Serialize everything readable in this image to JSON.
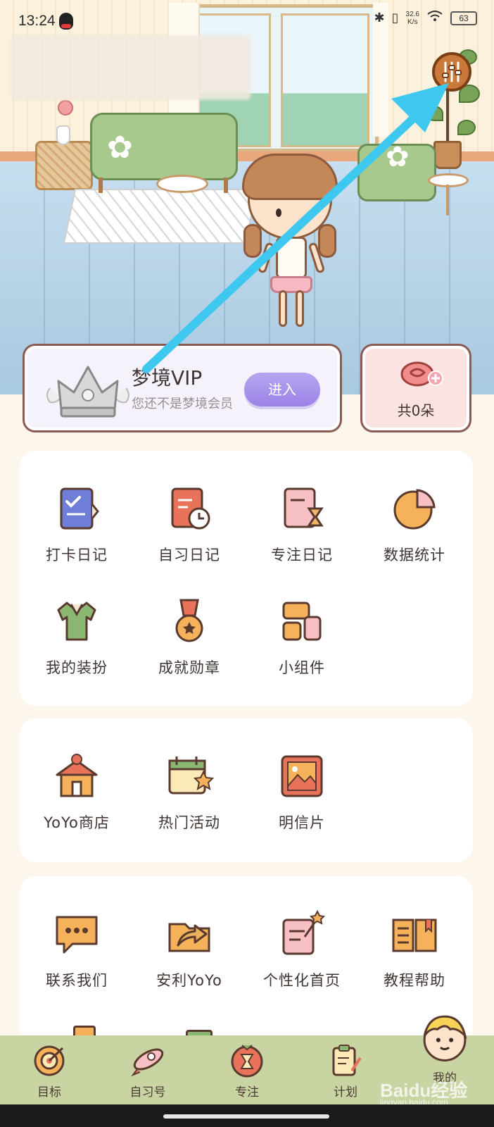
{
  "status_bar": {
    "time": "13:24",
    "speed_value": "32.6",
    "speed_unit": "K/s",
    "battery": "63"
  },
  "vip": {
    "title": "梦境VIP",
    "subtitle": "您还不是梦境会员",
    "enter_label": "进入"
  },
  "flowers": {
    "count_label": "共0朵"
  },
  "section1": {
    "items": [
      {
        "label": "打卡日记",
        "icon": "checklist-book-icon"
      },
      {
        "label": "自习日记",
        "icon": "clock-book-icon"
      },
      {
        "label": "专注日记",
        "icon": "hourglass-book-icon"
      },
      {
        "label": "数据统计",
        "icon": "pie-chart-icon"
      },
      {
        "label": "我的装扮",
        "icon": "shirt-icon"
      },
      {
        "label": "成就勋章",
        "icon": "medal-icon"
      },
      {
        "label": "小组件",
        "icon": "widget-icon"
      }
    ]
  },
  "section2": {
    "items": [
      {
        "label": "YoYo商店",
        "icon": "shop-icon"
      },
      {
        "label": "热门活动",
        "icon": "calendar-star-icon"
      },
      {
        "label": "明信片",
        "icon": "postcard-icon"
      }
    ]
  },
  "section3": {
    "items": [
      {
        "label": "联系我们",
        "icon": "chat-bubble-icon"
      },
      {
        "label": "安利YoYo",
        "icon": "share-folder-icon"
      },
      {
        "label": "个性化首页",
        "icon": "customize-icon"
      },
      {
        "label": "教程帮助",
        "icon": "open-book-icon"
      }
    ]
  },
  "bottom_nav": {
    "items": [
      {
        "label": "目标",
        "icon": "target-icon"
      },
      {
        "label": "自习号",
        "icon": "rocket-icon"
      },
      {
        "label": "专注",
        "icon": "tomato-hourglass-icon"
      },
      {
        "label": "计划",
        "icon": "clipboard-icon"
      },
      {
        "label": "我的",
        "icon": "avatar-icon"
      }
    ]
  },
  "watermark": {
    "brand": "Baidu经验",
    "url": "jingyan.baidu.com"
  },
  "colors": {
    "accent_purple": "#9b83e6",
    "card_border": "#8b5a55",
    "nav_bg": "#c8d4a2",
    "arrow": "#3ec8f0",
    "page_bg": "#fdf6ec"
  }
}
